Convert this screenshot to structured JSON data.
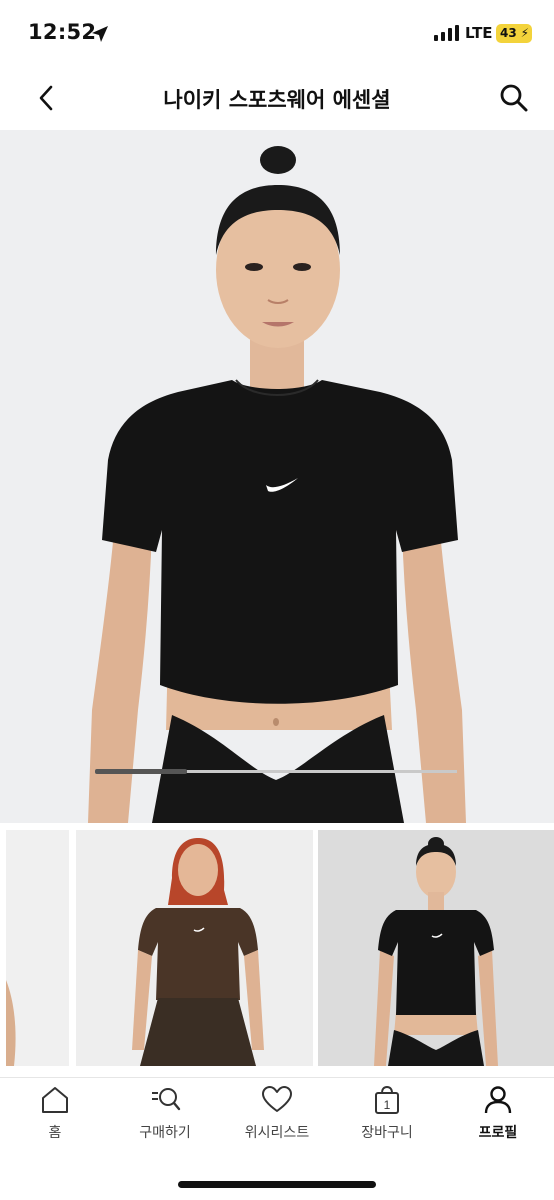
{
  "status_bar": {
    "time": "12:52",
    "network": "LTE",
    "battery": "43",
    "location_icon": "location-arrow-icon",
    "signal_icon": "signal-bars-icon"
  },
  "nav": {
    "title": "나이키 스포츠웨어 에센셜",
    "back_icon": "chevron-left-icon",
    "search_icon": "search-icon"
  },
  "gallery": {
    "scroll_position": 0.25,
    "thumbnails": [
      "arm-crop",
      "brown-top",
      "black-top"
    ]
  },
  "tabs": [
    {
      "label": "홈",
      "icon": "home-icon",
      "active": false
    },
    {
      "label": "구매하기",
      "icon": "list-search-icon",
      "active": false
    },
    {
      "label": "위시리스트",
      "icon": "heart-icon",
      "active": false
    },
    {
      "label": "장바구니",
      "icon": "cart-bag-icon",
      "badge": "1",
      "active": false
    },
    {
      "label": "프로필",
      "icon": "profile-icon",
      "active": true
    }
  ],
  "colors": {
    "battery": "#f3d33b",
    "shirt_black": "#141414",
    "shirt_brown": "#4a3527"
  }
}
